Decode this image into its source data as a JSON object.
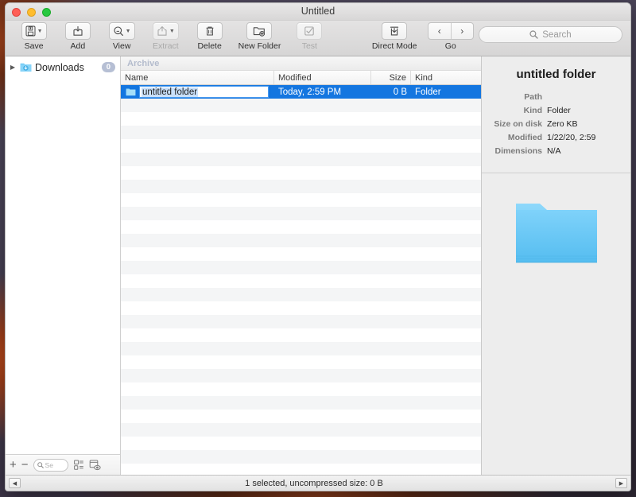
{
  "window": {
    "title": "Untitled",
    "traffic_lights": [
      "close-button",
      "minimize-button",
      "zoom-button"
    ]
  },
  "toolbar": {
    "items": [
      {
        "label": "Save",
        "icon": "save-disk-icon",
        "dropdown": true,
        "enabled": true
      },
      {
        "label": "Add",
        "icon": "add-box-icon",
        "dropdown": false,
        "enabled": true
      },
      {
        "label": "View",
        "icon": "view-search-icon",
        "dropdown": true,
        "enabled": true
      },
      {
        "label": "Extract",
        "icon": "extract-box-icon",
        "dropdown": true,
        "enabled": false
      },
      {
        "label": "Delete",
        "icon": "trash-icon",
        "dropdown": false,
        "enabled": true
      },
      {
        "label": "New Folder",
        "icon": "new-folder-icon",
        "dropdown": false,
        "enabled": true
      },
      {
        "label": "Test",
        "icon": "test-check-icon",
        "dropdown": false,
        "enabled": false
      },
      {
        "label": "Direct Mode",
        "icon": "direct-mode-icon",
        "dropdown": false,
        "enabled": true
      }
    ],
    "nav": {
      "label": "Go",
      "back_icon": "chevron-left-icon",
      "forward_icon": "chevron-right-icon"
    },
    "search": {
      "placeholder": "Search",
      "icon": "search-icon"
    }
  },
  "sidebar": {
    "items": [
      {
        "label": "Downloads",
        "badge": "0",
        "icon": "downloads-folder-icon",
        "disclosure": "▶"
      }
    ],
    "footer": {
      "add_label": "+",
      "remove_label": "−",
      "search_placeholder": "Se",
      "search_icon": "search-icon",
      "buttons": [
        "layout-icon",
        "preview-eye-icon"
      ]
    }
  },
  "filelist": {
    "breadcrumb": "Archive",
    "columns": [
      {
        "key": "name",
        "label": "Name"
      },
      {
        "key": "modified",
        "label": "Modified"
      },
      {
        "key": "size",
        "label": "Size"
      },
      {
        "key": "kind",
        "label": "Kind"
      }
    ],
    "rows": [
      {
        "name": "untitled folder",
        "modified": "Today, 2:59 PM",
        "size": "0 B",
        "kind": "Folder",
        "selected": true,
        "editing": true,
        "icon": "folder-icon"
      }
    ],
    "empty_row_count": 29
  },
  "info": {
    "title": "untitled folder",
    "fields": [
      {
        "key": "Path",
        "value": ""
      },
      {
        "key": "Kind",
        "value": "Folder"
      },
      {
        "key": "Size on disk",
        "value": "Zero KB"
      },
      {
        "key": "Modified",
        "value": "1/22/20, 2:59"
      },
      {
        "key": "Dimensions",
        "value": "N/A"
      }
    ],
    "preview_icon": "folder-icon-large"
  },
  "statusbar": {
    "text": "1 selected, uncompressed size: 0 B",
    "left_button": "◀",
    "right_button": "▶"
  },
  "colors": {
    "selection_blue": "#1476e0",
    "folder_blue": "#6ec9f5",
    "badge_gray": "#b6bfd4",
    "crumb_text": "#b4bccd"
  }
}
